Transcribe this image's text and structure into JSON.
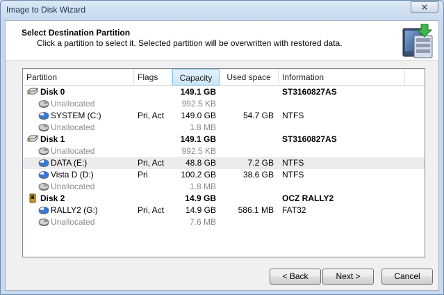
{
  "window": {
    "title": "Image to Disk Wizard",
    "close_glyph": "✕"
  },
  "header": {
    "title": "Select Destination Partition",
    "subtitle": "Click a partition to select it. Selected partition will be overwritten with restored data.",
    "icon": "disk-restore-icon"
  },
  "columns": {
    "partition": "Partition",
    "flags": "Flags",
    "capacity": "Capacity",
    "used_space": "Used space",
    "information": "Information",
    "sorted_column": "capacity"
  },
  "rows": [
    {
      "kind": "disk",
      "icon": "hard-disk-icon",
      "name": "Disk 0",
      "flags": "",
      "capacity": "149.1 GB",
      "used": "",
      "info": "ST3160827AS"
    },
    {
      "kind": "unalloc",
      "icon": "unallocated-icon",
      "name": "Unallocated",
      "flags": "",
      "capacity": "992.5 KB",
      "used": "",
      "info": ""
    },
    {
      "kind": "part",
      "icon": "partition-icon",
      "name": "SYSTEM (C:)",
      "flags": "Pri, Act",
      "capacity": "149.0 GB",
      "used": "54.7 GB",
      "info": "NTFS"
    },
    {
      "kind": "unalloc",
      "icon": "unallocated-icon",
      "name": "Unallocated",
      "flags": "",
      "capacity": "1.8 MB",
      "used": "",
      "info": ""
    },
    {
      "kind": "disk",
      "icon": "hard-disk-icon",
      "name": "Disk 1",
      "flags": "",
      "capacity": "149.1 GB",
      "used": "",
      "info": "ST3160827AS"
    },
    {
      "kind": "unalloc",
      "icon": "unallocated-icon",
      "name": "Unallocated",
      "flags": "",
      "capacity": "992.5 KB",
      "used": "",
      "info": ""
    },
    {
      "kind": "part",
      "icon": "partition-icon",
      "name": "DATA (E:)",
      "flags": "Pri, Act",
      "capacity": "48.8 GB",
      "used": "7.2 GB",
      "info": "NTFS",
      "highlight": true
    },
    {
      "kind": "part",
      "icon": "partition-icon",
      "name": "Vista D (D:)",
      "flags": "Pri",
      "capacity": "100.2 GB",
      "used": "38.6 GB",
      "info": "NTFS"
    },
    {
      "kind": "unalloc",
      "icon": "unallocated-icon",
      "name": "Unallocated",
      "flags": "",
      "capacity": "1.8 MB",
      "used": "",
      "info": ""
    },
    {
      "kind": "disk",
      "icon": "usb-drive-icon",
      "name": "Disk 2",
      "flags": "",
      "capacity": "14.9 GB",
      "used": "",
      "info": "OCZ RALLY2"
    },
    {
      "kind": "part",
      "icon": "partition-icon",
      "name": "RALLY2 (G:)",
      "flags": "Pri, Act",
      "capacity": "14.9 GB",
      "used": "586.1 MB",
      "info": "FAT32"
    },
    {
      "kind": "unalloc",
      "icon": "unallocated-icon",
      "name": "Unallocated",
      "flags": "",
      "capacity": "7.6 MB",
      "used": "",
      "info": ""
    }
  ],
  "buttons": {
    "back": "< Back",
    "next": "Next >",
    "cancel": "Cancel"
  },
  "colors": {
    "highlight_row": "#ebebeb",
    "sorted_header": "#c9e6f7",
    "disabled_text": "#8a8a8a"
  }
}
